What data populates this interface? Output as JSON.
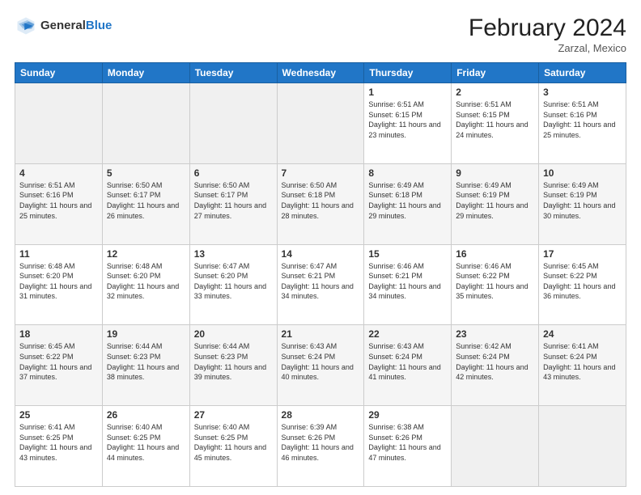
{
  "header": {
    "logo_general": "General",
    "logo_blue": "Blue",
    "month_title": "February 2024",
    "location": "Zarzal, Mexico"
  },
  "days_of_week": [
    "Sunday",
    "Monday",
    "Tuesday",
    "Wednesday",
    "Thursday",
    "Friday",
    "Saturday"
  ],
  "weeks": [
    [
      {
        "num": "",
        "text": "",
        "empty": true
      },
      {
        "num": "",
        "text": "",
        "empty": true
      },
      {
        "num": "",
        "text": "",
        "empty": true
      },
      {
        "num": "",
        "text": "",
        "empty": true
      },
      {
        "num": "1",
        "text": "Sunrise: 6:51 AM\nSunset: 6:15 PM\nDaylight: 11 hours and 23 minutes."
      },
      {
        "num": "2",
        "text": "Sunrise: 6:51 AM\nSunset: 6:15 PM\nDaylight: 11 hours and 24 minutes."
      },
      {
        "num": "3",
        "text": "Sunrise: 6:51 AM\nSunset: 6:16 PM\nDaylight: 11 hours and 25 minutes."
      }
    ],
    [
      {
        "num": "4",
        "text": "Sunrise: 6:51 AM\nSunset: 6:16 PM\nDaylight: 11 hours and 25 minutes."
      },
      {
        "num": "5",
        "text": "Sunrise: 6:50 AM\nSunset: 6:17 PM\nDaylight: 11 hours and 26 minutes."
      },
      {
        "num": "6",
        "text": "Sunrise: 6:50 AM\nSunset: 6:17 PM\nDaylight: 11 hours and 27 minutes."
      },
      {
        "num": "7",
        "text": "Sunrise: 6:50 AM\nSunset: 6:18 PM\nDaylight: 11 hours and 28 minutes."
      },
      {
        "num": "8",
        "text": "Sunrise: 6:49 AM\nSunset: 6:18 PM\nDaylight: 11 hours and 29 minutes."
      },
      {
        "num": "9",
        "text": "Sunrise: 6:49 AM\nSunset: 6:19 PM\nDaylight: 11 hours and 29 minutes."
      },
      {
        "num": "10",
        "text": "Sunrise: 6:49 AM\nSunset: 6:19 PM\nDaylight: 11 hours and 30 minutes."
      }
    ],
    [
      {
        "num": "11",
        "text": "Sunrise: 6:48 AM\nSunset: 6:20 PM\nDaylight: 11 hours and 31 minutes."
      },
      {
        "num": "12",
        "text": "Sunrise: 6:48 AM\nSunset: 6:20 PM\nDaylight: 11 hours and 32 minutes."
      },
      {
        "num": "13",
        "text": "Sunrise: 6:47 AM\nSunset: 6:20 PM\nDaylight: 11 hours and 33 minutes."
      },
      {
        "num": "14",
        "text": "Sunrise: 6:47 AM\nSunset: 6:21 PM\nDaylight: 11 hours and 34 minutes."
      },
      {
        "num": "15",
        "text": "Sunrise: 6:46 AM\nSunset: 6:21 PM\nDaylight: 11 hours and 34 minutes."
      },
      {
        "num": "16",
        "text": "Sunrise: 6:46 AM\nSunset: 6:22 PM\nDaylight: 11 hours and 35 minutes."
      },
      {
        "num": "17",
        "text": "Sunrise: 6:45 AM\nSunset: 6:22 PM\nDaylight: 11 hours and 36 minutes."
      }
    ],
    [
      {
        "num": "18",
        "text": "Sunrise: 6:45 AM\nSunset: 6:22 PM\nDaylight: 11 hours and 37 minutes."
      },
      {
        "num": "19",
        "text": "Sunrise: 6:44 AM\nSunset: 6:23 PM\nDaylight: 11 hours and 38 minutes."
      },
      {
        "num": "20",
        "text": "Sunrise: 6:44 AM\nSunset: 6:23 PM\nDaylight: 11 hours and 39 minutes."
      },
      {
        "num": "21",
        "text": "Sunrise: 6:43 AM\nSunset: 6:24 PM\nDaylight: 11 hours and 40 minutes."
      },
      {
        "num": "22",
        "text": "Sunrise: 6:43 AM\nSunset: 6:24 PM\nDaylight: 11 hours and 41 minutes."
      },
      {
        "num": "23",
        "text": "Sunrise: 6:42 AM\nSunset: 6:24 PM\nDaylight: 11 hours and 42 minutes."
      },
      {
        "num": "24",
        "text": "Sunrise: 6:41 AM\nSunset: 6:24 PM\nDaylight: 11 hours and 43 minutes."
      }
    ],
    [
      {
        "num": "25",
        "text": "Sunrise: 6:41 AM\nSunset: 6:25 PM\nDaylight: 11 hours and 43 minutes."
      },
      {
        "num": "26",
        "text": "Sunrise: 6:40 AM\nSunset: 6:25 PM\nDaylight: 11 hours and 44 minutes."
      },
      {
        "num": "27",
        "text": "Sunrise: 6:40 AM\nSunset: 6:25 PM\nDaylight: 11 hours and 45 minutes."
      },
      {
        "num": "28",
        "text": "Sunrise: 6:39 AM\nSunset: 6:26 PM\nDaylight: 11 hours and 46 minutes."
      },
      {
        "num": "29",
        "text": "Sunrise: 6:38 AM\nSunset: 6:26 PM\nDaylight: 11 hours and 47 minutes."
      },
      {
        "num": "",
        "text": "",
        "empty": true
      },
      {
        "num": "",
        "text": "",
        "empty": true
      }
    ]
  ]
}
